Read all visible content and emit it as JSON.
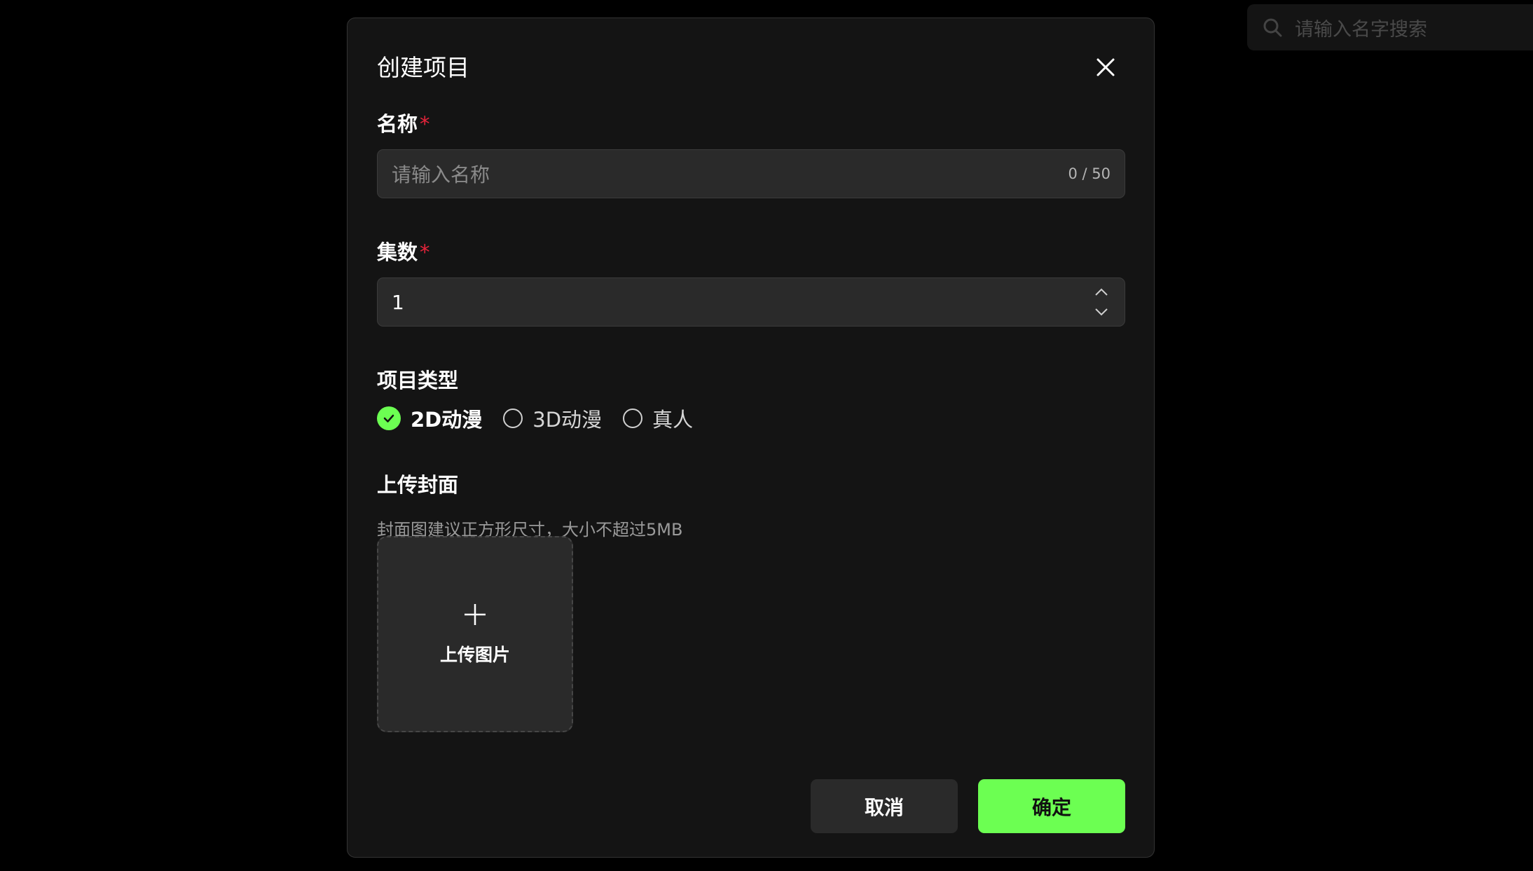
{
  "background": {
    "search_placeholder": "请输入名字搜索"
  },
  "modal": {
    "title": "创建项目",
    "close_icon": "close-icon"
  },
  "name_field": {
    "label": "名称",
    "required_mark": "*",
    "placeholder": "请输入名称",
    "char_count": "0 / 50"
  },
  "episodes_field": {
    "label": "集数",
    "required_mark": "*",
    "value": "1"
  },
  "project_type": {
    "label": "项目类型",
    "options": [
      {
        "label": "2D动漫",
        "selected": true
      },
      {
        "label": "3D动漫",
        "selected": false
      },
      {
        "label": "真人",
        "selected": false
      }
    ]
  },
  "cover": {
    "label": "上传封面",
    "hint": "封面图建议正方形尺寸，大小不超过5MB",
    "upload_label": "上传图片"
  },
  "actions": {
    "cancel_label": "取消",
    "confirm_label": "确定"
  },
  "colors": {
    "accent": "#6cff52",
    "required": "#e5243b",
    "modal_bg": "#141414",
    "input_bg": "#2a2a2a"
  }
}
